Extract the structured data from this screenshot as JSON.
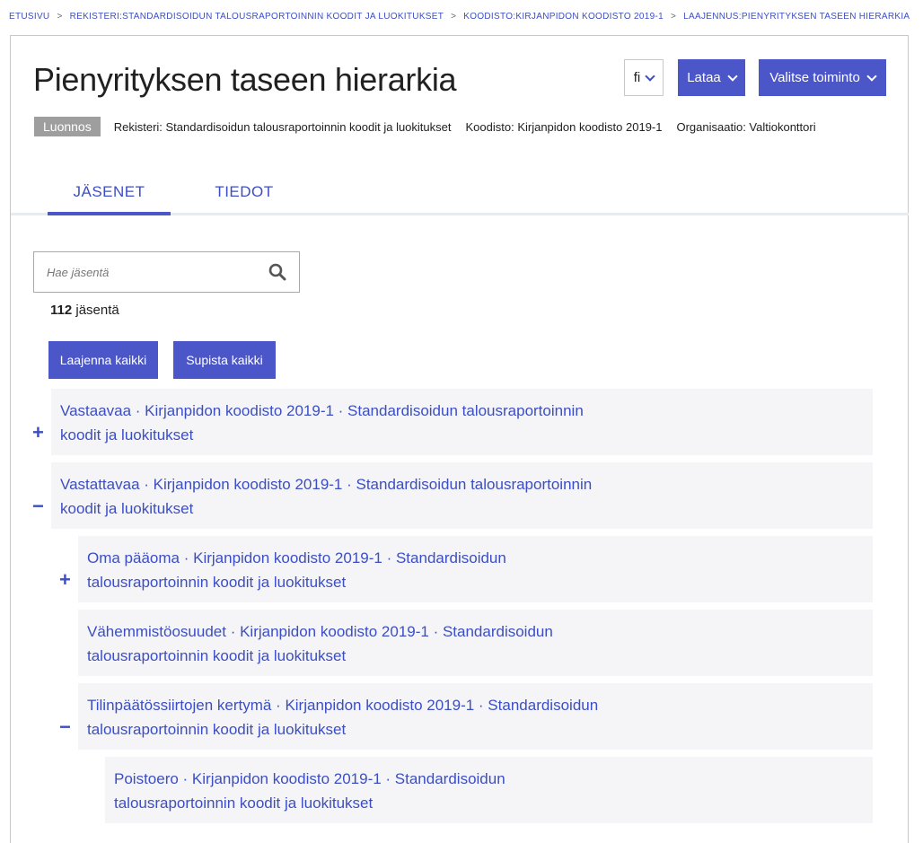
{
  "breadcrumb": [
    "ETUSIVU",
    "REKISTERI:STANDARDISOIDUN TALOUSRAPORTOINNIN KOODIT JA LUOKITUKSET",
    "KOODISTO:KIRJANPIDON KOODISTO 2019-1",
    "LAAJENNUS:PIENYRITYKSEN TASEEN HIERARKIA"
  ],
  "breadcrumb_sep": ">",
  "page": {
    "title": "Pienyrityksen taseen hierarkia",
    "language": "fi",
    "download_label": "Lataa",
    "action_label": "Valitse toiminto",
    "status_badge": "Luonnos",
    "registry": "Rekisteri: Standardisoidun talousraportoinnin koodit ja luokitukset",
    "codelist": "Koodisto: Kirjanpidon koodisto 2019-1",
    "organization": "Organisaatio: Valtiokonttori"
  },
  "tabs": [
    {
      "label": "JÄSENET",
      "active": true
    },
    {
      "label": "TIEDOT",
      "active": false
    }
  ],
  "search": {
    "placeholder": "Hae jäsentä"
  },
  "count": {
    "number": "112",
    "label": "jäsentä"
  },
  "buttons": {
    "expand_all": "Laajenna kaikki",
    "collapse_all": "Supista kaikki"
  },
  "tree": [
    {
      "line1": "Vastaavaa · Kirjanpidon koodisto 2019-1 · Standardisoidun talousraportoinnin",
      "line2": "koodit ja luokitukset",
      "toggle": "+"
    },
    {
      "line1": "Vastattavaa · Kirjanpidon koodisto 2019-1 · Standardisoidun talousraportoinnin",
      "line2": "koodit ja luokitukset",
      "toggle": "−"
    },
    {
      "line1": "Oma pääoma · Kirjanpidon koodisto 2019-1 · Standardisoidun",
      "line2": "talousraportoinnin koodit ja luokitukset",
      "toggle": "+"
    },
    {
      "line1": "Vähemmistöosuudet · Kirjanpidon koodisto 2019-1 · Standardisoidun",
      "line2": "talousraportoinnin koodit ja luokitukset",
      "toggle": ""
    },
    {
      "line1": "Tilinpäätössiirtojen kertymä · Kirjanpidon koodisto 2019-1 · Standardisoidun",
      "line2": "talousraportoinnin koodit ja luokitukset",
      "toggle": "−"
    },
    {
      "line1": "Poistoero · Kirjanpidon koodisto 2019-1 · Standardisoidun",
      "line2": "talousraportoinnin koodit ja luokitukset",
      "toggle": ""
    }
  ]
}
